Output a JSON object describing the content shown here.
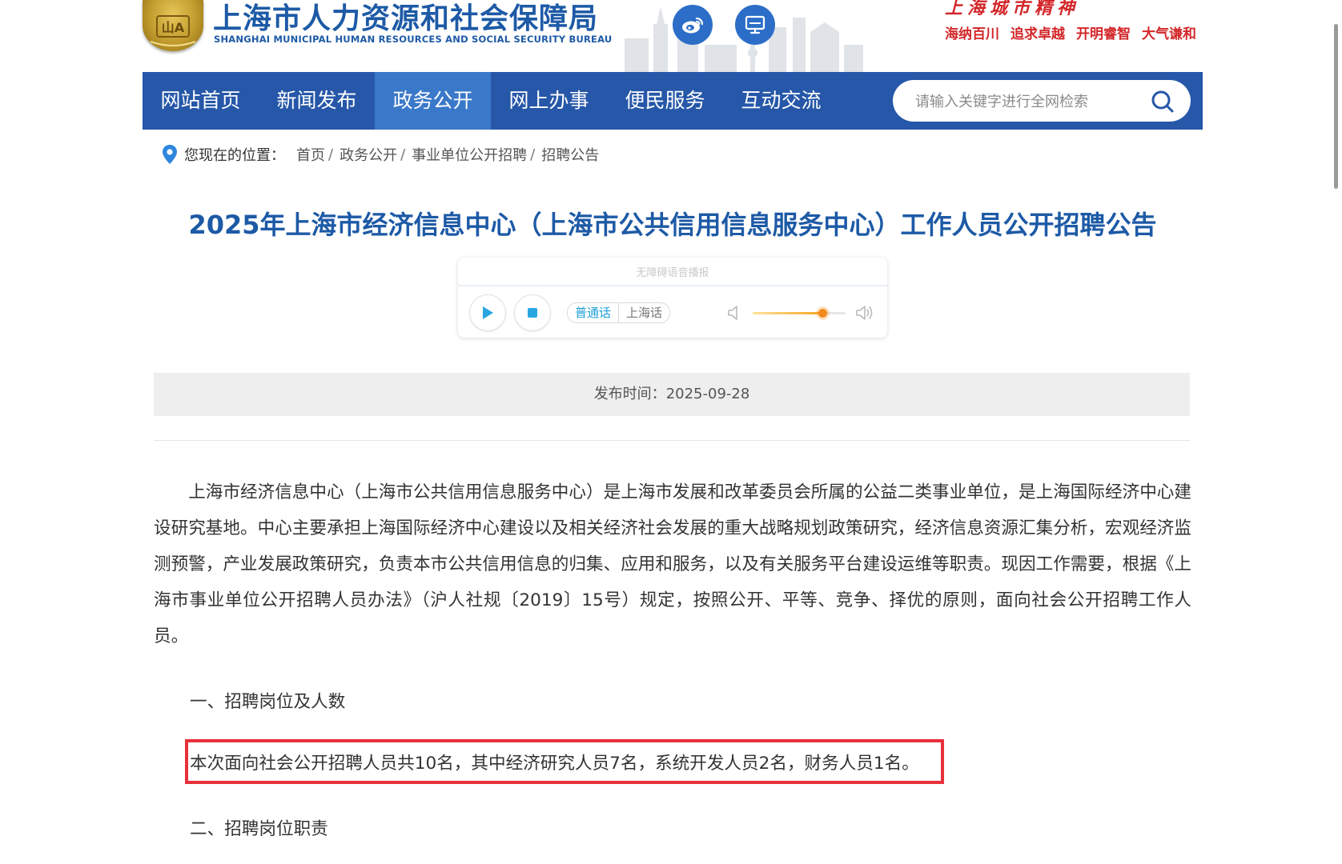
{
  "site": {
    "name": "上海市人力资源和社会保障局",
    "name_en": "SHANGHAI MUNICIPAL HUMAN RESOURCES AND SOCIAL SECURITY BUREAU",
    "slogan_title": "上海城市精神",
    "slogans": [
      "海纳百川",
      "追求卓越",
      "开明睿智",
      "大气谦和"
    ]
  },
  "header_icons": {
    "weibo": "weibo-icon",
    "screen": "monitor-icon"
  },
  "nav": {
    "items": [
      {
        "label": "网站首页",
        "active": false
      },
      {
        "label": "新闻发布",
        "active": false
      },
      {
        "label": "政务公开",
        "active": true
      },
      {
        "label": "网上办事",
        "active": false
      },
      {
        "label": "便民服务",
        "active": false
      },
      {
        "label": "互动交流",
        "active": false
      }
    ],
    "search_placeholder": "请输入关键字进行全网检索",
    "search_value": "",
    "colors": {
      "bar": "#2657a8",
      "active": "#3a78c9"
    }
  },
  "breadcrumb": {
    "label": "您现在的位置：",
    "items": [
      "首页",
      "政务公开",
      "事业单位公开招聘",
      "招聘公告"
    ],
    "separator": "/"
  },
  "article": {
    "title": "2025年上海市经济信息中心（上海市公共信用信息服务中心）工作人员公开招聘公告",
    "publish_label": "发布时间：",
    "publish_date": "2025-09-28",
    "intro": "上海市经济信息中心（上海市公共信用信息服务中心）是上海市发展和改革委员会所属的公益二类事业单位，是上海国际经济中心建设研究基地。中心主要承担上海国际经济中心建设以及相关经济社会发展的重大战略规划政策研究，经济信息资源汇集分析，宏观经济监测预警，产业发展政策研究，负责本市公共信用信息的归集、应用和服务，以及有关服务平台建设运维等职责。现因工作需要，根据《上海市事业单位公开招聘人员办法》（沪人社规〔2019〕15号）规定，按照公开、平等、竞争、择优的原则，面向社会公开招聘工作人员。",
    "section1_title": "一、招聘岗位及人数",
    "section1_text": "本次面向社会公开招聘人员共10名，其中经济研究人员7名，系统开发人员2名，财务人员1名。",
    "section2_title": "二、招聘岗位职责",
    "highlight_color": "#e8303a"
  },
  "audio_player": {
    "label": "无障碍语音播报",
    "languages": [
      {
        "label": "普通话",
        "active": true
      },
      {
        "label": "上海话",
        "active": false
      }
    ],
    "volume": 0.75
  }
}
